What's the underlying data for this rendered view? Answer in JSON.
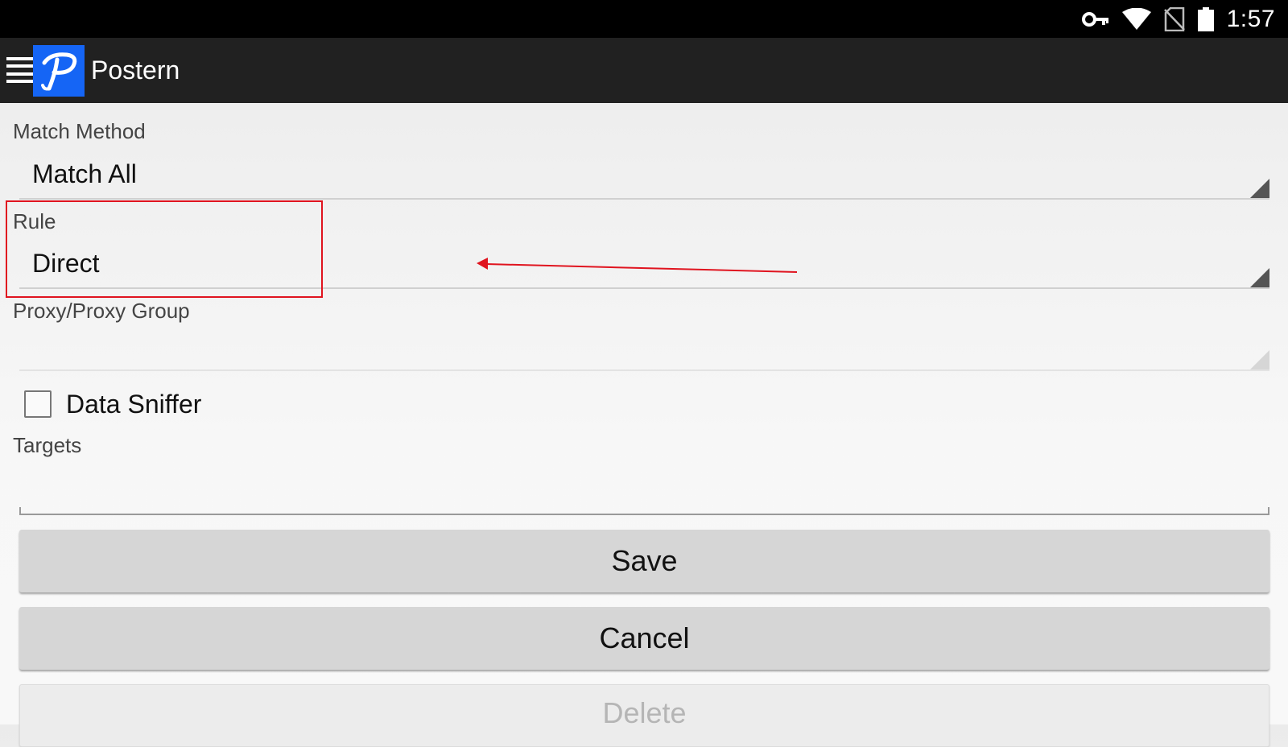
{
  "status_bar": {
    "time": "1:57",
    "icons": [
      "vpn-key-icon",
      "wifi-icon",
      "no-sim-icon",
      "battery-icon"
    ]
  },
  "app_bar": {
    "title": "Postern",
    "logo_icon": "postern-logo-icon",
    "menu_icon": "hamburger-menu-icon"
  },
  "form": {
    "match_method": {
      "label": "Match Method",
      "value": "Match All"
    },
    "rule": {
      "label": "Rule",
      "value": "Direct"
    },
    "proxy_group": {
      "label": "Proxy/Proxy Group",
      "value": ""
    },
    "data_sniffer": {
      "label": "Data Sniffer",
      "checked": false
    },
    "targets": {
      "label": "Targets",
      "value": ""
    }
  },
  "buttons": {
    "save": "Save",
    "cancel": "Cancel",
    "delete": "Delete"
  },
  "colors": {
    "status_bar": "#000000",
    "app_bar": "#212121",
    "logo_bg": "#1565f5",
    "annotation": "#e0141f",
    "button": "#d6d6d6"
  }
}
